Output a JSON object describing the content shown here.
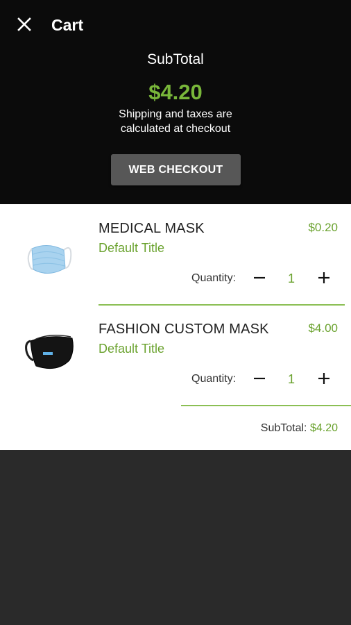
{
  "header": {
    "title": "Cart",
    "close_icon": "close-icon",
    "subtotal_label": "SubTotal",
    "subtotal_value": "$4.20",
    "shipping_note_line1": "Shipping and taxes are",
    "shipping_note_line2": "calculated at checkout",
    "checkout_label": "WEB CHECKOUT"
  },
  "cart": {
    "qty_label": "Quantity:",
    "items": [
      {
        "name": "MEDICAL MASK",
        "variant": "Default Title",
        "price": "$0.20",
        "quantity": "1",
        "image": "surgical-mask-image"
      },
      {
        "name": "FASHION CUSTOM MASK",
        "variant": "Default Title",
        "price": "$4.00",
        "quantity": "1",
        "image": "black-mask-image"
      }
    ],
    "subtotal_label": "SubTotal:",
    "subtotal_value": "$4.20"
  },
  "colors": {
    "accent": "#6aa22e",
    "header_bg": "#0b0b0b",
    "button_bg": "#575757",
    "page_bg": "#2a2a2a"
  }
}
